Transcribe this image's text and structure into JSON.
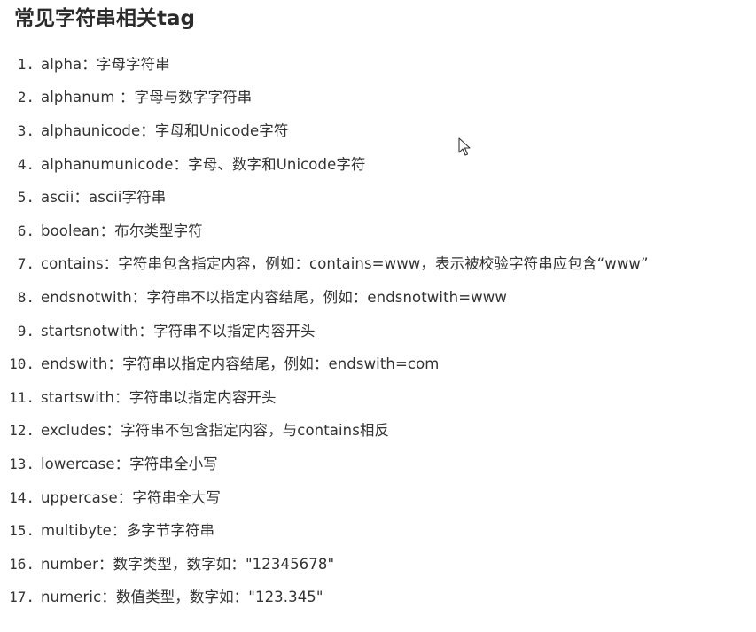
{
  "title": "常见字符串相关tag",
  "items": [
    {
      "num": "1.",
      "text": "alpha：字母字符串"
    },
    {
      "num": "2.",
      "text": "alphanum ：字母与数字字符串"
    },
    {
      "num": "3.",
      "text": "alphaunicode：字母和Unicode字符"
    },
    {
      "num": "4.",
      "text": "alphanumunicode：字母、数字和Unicode字符"
    },
    {
      "num": "5.",
      "text": "ascii：ascii字符串"
    },
    {
      "num": "6.",
      "text": "boolean：布尔类型字符"
    },
    {
      "num": "7.",
      "text": "contains：字符串包含指定内容，例如：contains=www，表示被校验字符串应包含“www”"
    },
    {
      "num": "8.",
      "text": "endsnotwith：字符串不以指定内容结尾，例如：endsnotwith=www"
    },
    {
      "num": "9.",
      "text": "startsnotwith：字符串不以指定内容开头"
    },
    {
      "num": "10.",
      "text": "endswith：字符串以指定内容结尾，例如：endswith=com"
    },
    {
      "num": "11.",
      "text": "startswith：字符串以指定内容开头"
    },
    {
      "num": "12.",
      "text": "excludes：字符串不包含指定内容，与contains相反"
    },
    {
      "num": "13.",
      "text": "lowercase：字符串全小写"
    },
    {
      "num": "14.",
      "text": "uppercase：字符串全大写"
    },
    {
      "num": "15.",
      "text": "multibyte：多字节字符串"
    },
    {
      "num": "16.",
      "text": "number：数字类型，数字如：\"12345678\""
    },
    {
      "num": "17.",
      "text": "numeric：数值类型，数字如：\"123.345\""
    }
  ],
  "icons": {
    "cursor": "mouse-pointer-icon"
  }
}
